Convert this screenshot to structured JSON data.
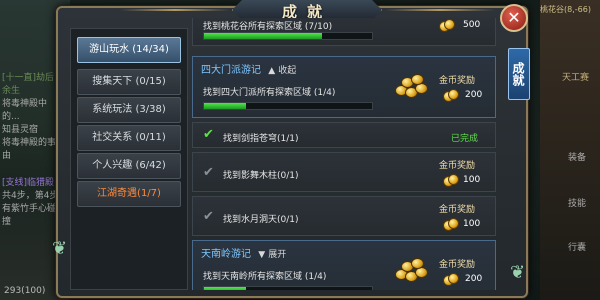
{
  "window": {
    "title": "成就",
    "close_glyph": "✕",
    "side_tab": "成就"
  },
  "background_text": {
    "left": [
      "[十一直]劫后余生",
      "将毒神殿中的...",
      "知县灵宿",
      "将毒神殿的事由",
      "[支线]临猎殿",
      "共4步，第4步",
      "有紫竹手心碰撞"
    ],
    "right": [
      "桃花谷(8,-66)",
      "天工赛",
      "装备",
      "技能",
      "行囊"
    ],
    "bottom_left": "293(100)"
  },
  "nav": {
    "items": [
      {
        "label": "游山玩水 (14/34)",
        "active": true
      },
      {
        "label": "搜集天下 (0/15)"
      },
      {
        "label": "系统玩法 (3/38)"
      },
      {
        "label": "社交关系 (0/11)"
      },
      {
        "label": "个人兴趣 (6/42)"
      },
      {
        "label": "江湖奇遇(1/7)",
        "highlight": true
      }
    ]
  },
  "entries": {
    "top_partial": {
      "text": "找到桃花谷所有探索区域 (7/10)",
      "progress": 0.7,
      "reward_value": "500"
    },
    "sidamen": {
      "header": "四大门派游记",
      "toggle_icon": "chevron-up",
      "toggle_label": "收起",
      "text": "找到四大门派所有探索区域 (1/4)",
      "progress": 0.25,
      "reward_label": "金币奖励",
      "reward_value": "200",
      "subs": [
        {
          "text": "找到剑指苍穹(1/1)",
          "done": true,
          "status": "已完成"
        },
        {
          "text": "找到影舞木柱(0/1)",
          "done": false,
          "reward_label": "金币奖励",
          "reward_value": "100"
        },
        {
          "text": "找到水月洞天(0/1)",
          "done": false,
          "reward_label": "金币奖励",
          "reward_value": "100"
        }
      ]
    },
    "tiannanling": {
      "header": "天南岭游记",
      "toggle_icon": "chevron-down",
      "toggle_label": "展开",
      "text": "找到天南岭所有探索区域 (1/4)",
      "progress": 0.25,
      "reward_label": "金币奖励",
      "reward_value": "200"
    }
  },
  "colors": {
    "accent_blue": "#7ec6ff",
    "done_green": "#5fe04a",
    "progress_green": "#2fcf34",
    "nav_highlight": "#ff8a3c"
  }
}
